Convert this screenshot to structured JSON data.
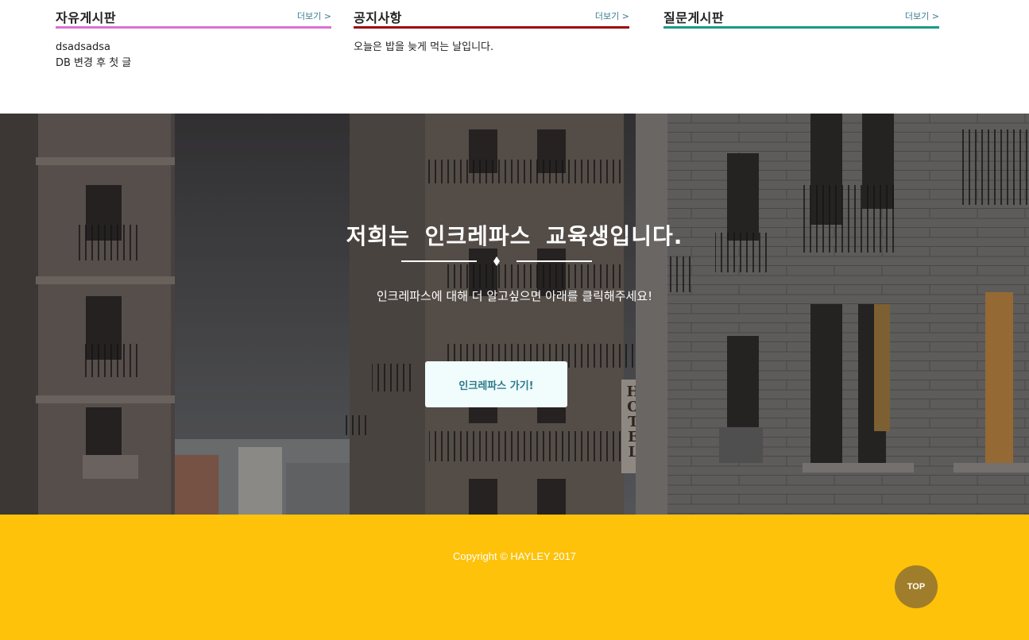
{
  "boards": [
    {
      "title": "자유게시판",
      "more": "더보기 >",
      "accent": "#da70d6",
      "posts": [
        "dsadsadsa",
        "DB 변경 후 첫 글"
      ]
    },
    {
      "title": "공지사항",
      "more": "더보기 >",
      "accent": "#9b0a0a",
      "posts": [
        "오늘은 밥을 늦게 먹는 날입니다."
      ]
    },
    {
      "title": "질문게시판",
      "more": "더보기 >",
      "accent": "#1a9a88",
      "posts": []
    }
  ],
  "hero": {
    "title": "저희는 인크레파스 교육생입니다.",
    "subtitle": "인크레파스에 대해 더 알고싶으면 아래를 클릭해주세요!",
    "button_label": "인크레파스 가기!",
    "hotel_sign": "HOTEL"
  },
  "footer": {
    "copyright": "Copyright © HAYLEY 2017",
    "top_label": "TOP",
    "background": "#fdc209"
  }
}
